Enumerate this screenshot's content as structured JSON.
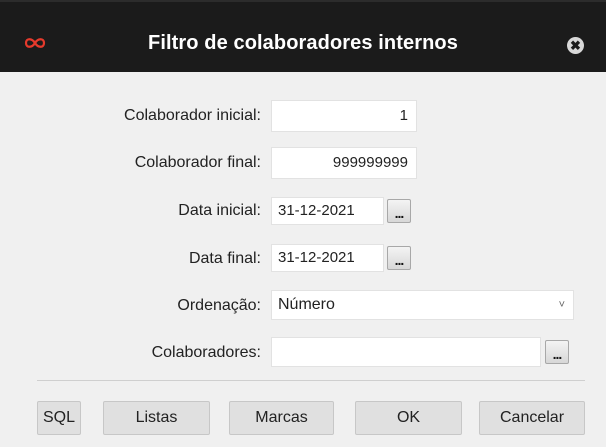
{
  "dialog": {
    "title": "Filtro de colaboradores internos",
    "close_symbol": "✖",
    "logo_icon": "infinity-logo-icon",
    "accent_color": "#e63a2c"
  },
  "form": {
    "colaborador_inicial": {
      "label": "Colaborador inicial:",
      "value": "1"
    },
    "colaborador_final": {
      "label": "Colaborador final:",
      "value": "999999999"
    },
    "data_inicial": {
      "label": "Data inicial:",
      "value": "31-12-2021",
      "button": "..."
    },
    "data_final": {
      "label": "Data final:",
      "value": "31-12-2021",
      "button": "..."
    },
    "ordenacao": {
      "label": "Ordenação:",
      "value": "Número",
      "chevron": "˅"
    },
    "colaboradores": {
      "label": "Colaboradores:",
      "value": "",
      "button": "..."
    }
  },
  "buttons": {
    "sql": "SQL",
    "listas": "Listas",
    "marcas": "Marcas",
    "ok": "OK",
    "cancelar": "Cancelar"
  }
}
